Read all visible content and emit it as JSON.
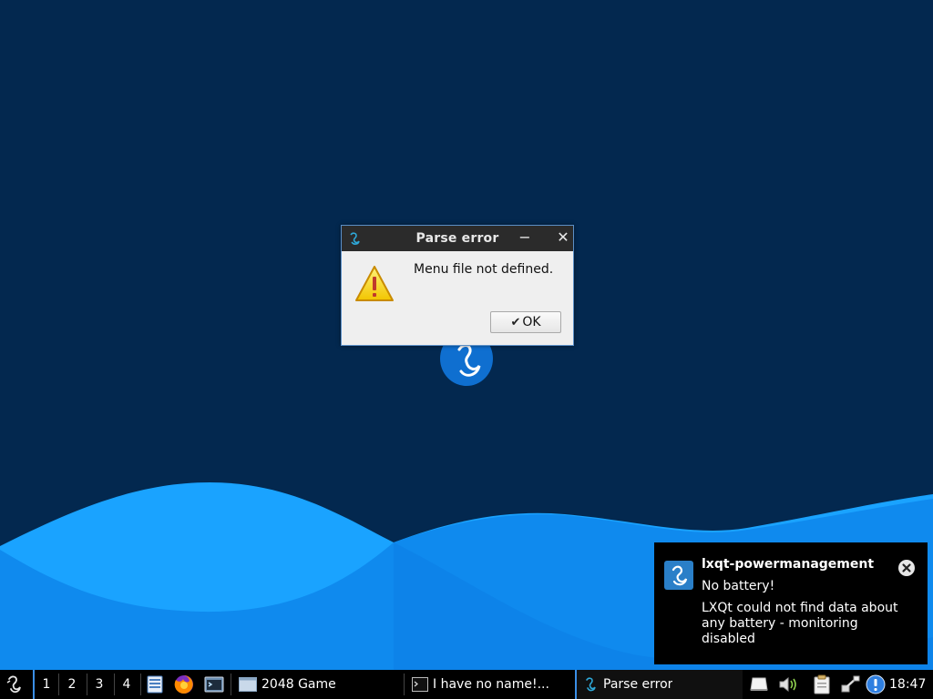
{
  "dialog": {
    "title": "Parse error",
    "minimize_glyph": "−",
    "close_glyph": "✕",
    "message": "Menu file not defined.",
    "ok_label": "OK",
    "icon": "warning-icon"
  },
  "notification": {
    "app": "lxqt-powermanagement",
    "summary": "No battery!",
    "body": "LXQt could not find data about any battery - monitoring disabled"
  },
  "taskbar": {
    "workspaces": [
      "1",
      "2",
      "3",
      "4"
    ],
    "quicklaunch": [
      "file-manager-icon",
      "firefox-icon",
      "terminal-launcher-icon"
    ],
    "tasks": [
      {
        "label": "2048 Game"
      },
      {
        "label": "I have no name!..."
      },
      {
        "label": "Parse error"
      }
    ],
    "tray": [
      "removable-drive-icon",
      "volume-icon",
      "clipboard-icon",
      "network-icon",
      "update-notifier-icon"
    ],
    "clock": "18:47"
  },
  "colors": {
    "desktop_bg": "#03284f",
    "wave_light": "#1aa3ff",
    "wave_mid": "#1287f0",
    "accent": "#3a8ee6"
  }
}
